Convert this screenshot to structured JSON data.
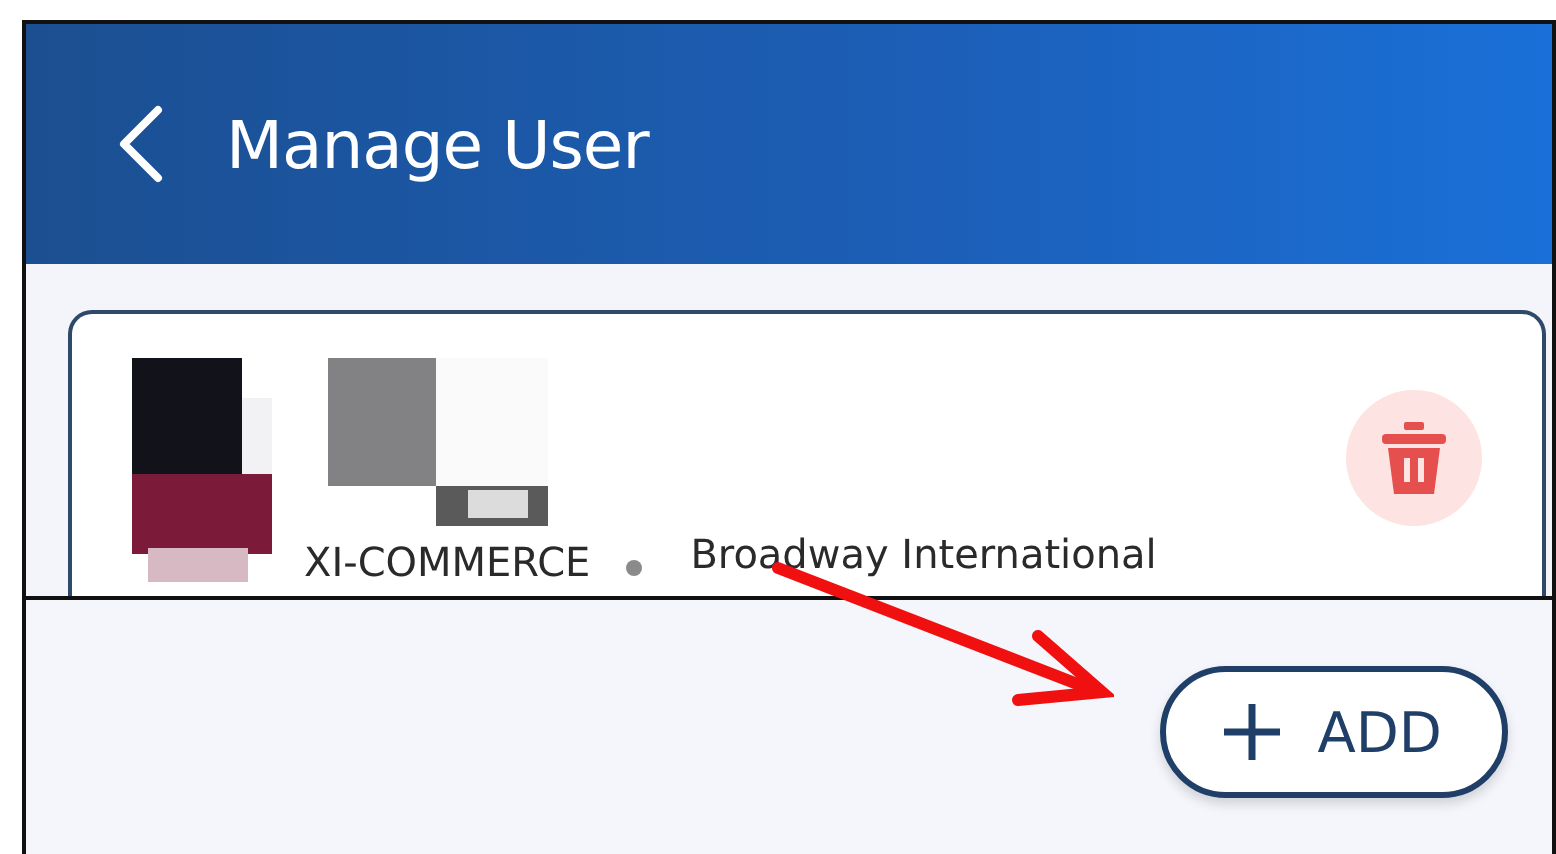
{
  "header": {
    "title": "Manage User"
  },
  "users": [
    {
      "organization": "XI-COMMERCE",
      "school": "Broadway International"
    }
  ],
  "add_button": {
    "label": "ADD"
  }
}
